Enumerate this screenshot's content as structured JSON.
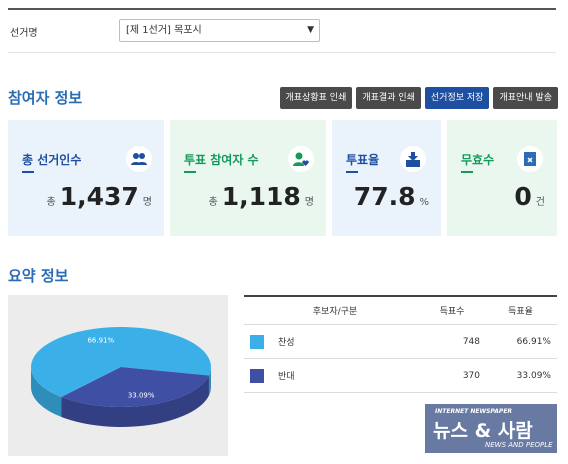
{
  "election": {
    "label": "선거명",
    "selected": "[제 1선거] 목포시"
  },
  "participants": {
    "title": "참여자 정보",
    "buttons": [
      "개표상황표 인쇄",
      "개표결과 인쇄",
      "선거정보 저장",
      "개표안내 발송"
    ],
    "cards": [
      {
        "label": "총 선거인수",
        "prefix": "총",
        "value": "1,437",
        "unit": "명",
        "icon": "people-icon"
      },
      {
        "label": "투표 참여자 수",
        "prefix": "총",
        "value": "1,118",
        "unit": "명",
        "icon": "user-heart-icon"
      },
      {
        "label": "투표율",
        "prefix": "",
        "value": "77.8",
        "unit": "%",
        "icon": "ballot-box-icon"
      },
      {
        "label": "무효수",
        "prefix": "",
        "value": "0",
        "unit": "건",
        "icon": "invalid-doc-icon"
      }
    ]
  },
  "summary": {
    "title": "요약 정보",
    "table": {
      "headers": [
        "후보자/구분",
        "득표수",
        "득표율"
      ],
      "rows": [
        {
          "name": "찬성",
          "votes": "748",
          "rate": "66.91%",
          "color": "#3bb0e8"
        },
        {
          "name": "반대",
          "votes": "370",
          "rate": "33.09%",
          "color": "#3f4fa3"
        }
      ]
    }
  },
  "chart_data": {
    "type": "pie",
    "labels": [
      "찬성",
      "반대"
    ],
    "values": [
      66.91,
      33.09
    ],
    "value_labels": [
      "66.91%",
      "33.09%"
    ],
    "colors": [
      "#3bb0e8",
      "#3f4fa3"
    ]
  },
  "watermark": {
    "top": "INTERNET NEWSPAPER",
    "main": "뉴스 & 사람",
    "bottom": "NEWS AND PEOPLE"
  }
}
